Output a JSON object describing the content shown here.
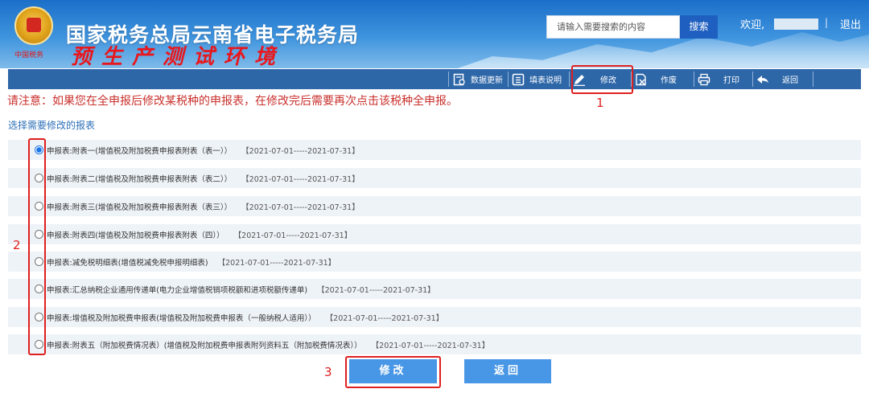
{
  "header": {
    "site_title": "国家税务总局云南省电子税务局",
    "env_title": "预生产测试环境",
    "emblem_caption": "中国税务",
    "search_placeholder": "请输入需要搜索的内容",
    "search_button": "搜索",
    "welcome": "欢迎,",
    "separator": "|",
    "logout": "退出"
  },
  "toolbar": {
    "items": [
      {
        "label": "数据更新",
        "icon": "data-refresh-icon"
      },
      {
        "label": "填表说明",
        "icon": "doc-list-icon"
      },
      {
        "label": "修改",
        "icon": "edit-pencil-icon"
      },
      {
        "label": "作废",
        "icon": "void-doc-icon"
      },
      {
        "label": "打印",
        "icon": "printer-icon"
      },
      {
        "label": "返回",
        "icon": "back-arrow-icon"
      }
    ]
  },
  "notice": "请注意：如果您在全申报后修改某税种的申报表，在修改完后需要再次点击该税种全申报。",
  "section_title": "选择需要修改的报表",
  "reports": [
    {
      "title": "申报表:附表一(增值税及附加税费申报表附表（表一））",
      "period": "【2021-07-01-----2021-07-31】",
      "selected": true
    },
    {
      "title": "申报表:附表二(增值税及附加税费申报表附表（表二））",
      "period": "【2021-07-01-----2021-07-31】",
      "selected": false
    },
    {
      "title": "申报表:附表三(增值税及附加税费申报表附表（表三））",
      "period": "【2021-07-01-----2021-07-31】",
      "selected": false
    },
    {
      "title": "申报表:附表四(增值税及附加税费申报表附表（四））",
      "period": "【2021-07-01-----2021-07-31】",
      "selected": false
    },
    {
      "title": "申报表:减免税明细表(增值税减免税申报明细表)",
      "period": "【2021-07-01-----2021-07-31】",
      "selected": false
    },
    {
      "title": "申报表:汇总纳税企业通用传递单(电力企业增值税销项税额和进项税额传递单)",
      "period": "【2021-07-01-----2021-07-31】",
      "selected": false
    },
    {
      "title": "申报表:增值税及附加税费申报表(增值税及附加税费申报表（一般纳税人适用））",
      "period": "【2021-07-01-----2021-07-31】",
      "selected": false
    },
    {
      "title": "申报表:附表五（附加税费情况表）(增值税及附加税费申报表附列资料五（附加税费情况表））",
      "period": "【2021-07-01-----2021-07-31】",
      "selected": false
    }
  ],
  "buttons": {
    "modify": "修改",
    "back": "返回"
  },
  "annotations": {
    "one": "1",
    "two": "2",
    "three": "3"
  },
  "colors": {
    "banner": "#2a7fd4",
    "toolbar": "#2e67a8",
    "notice": "#c9302c",
    "button": "#4896e6",
    "annotation": "#e01f1f"
  }
}
